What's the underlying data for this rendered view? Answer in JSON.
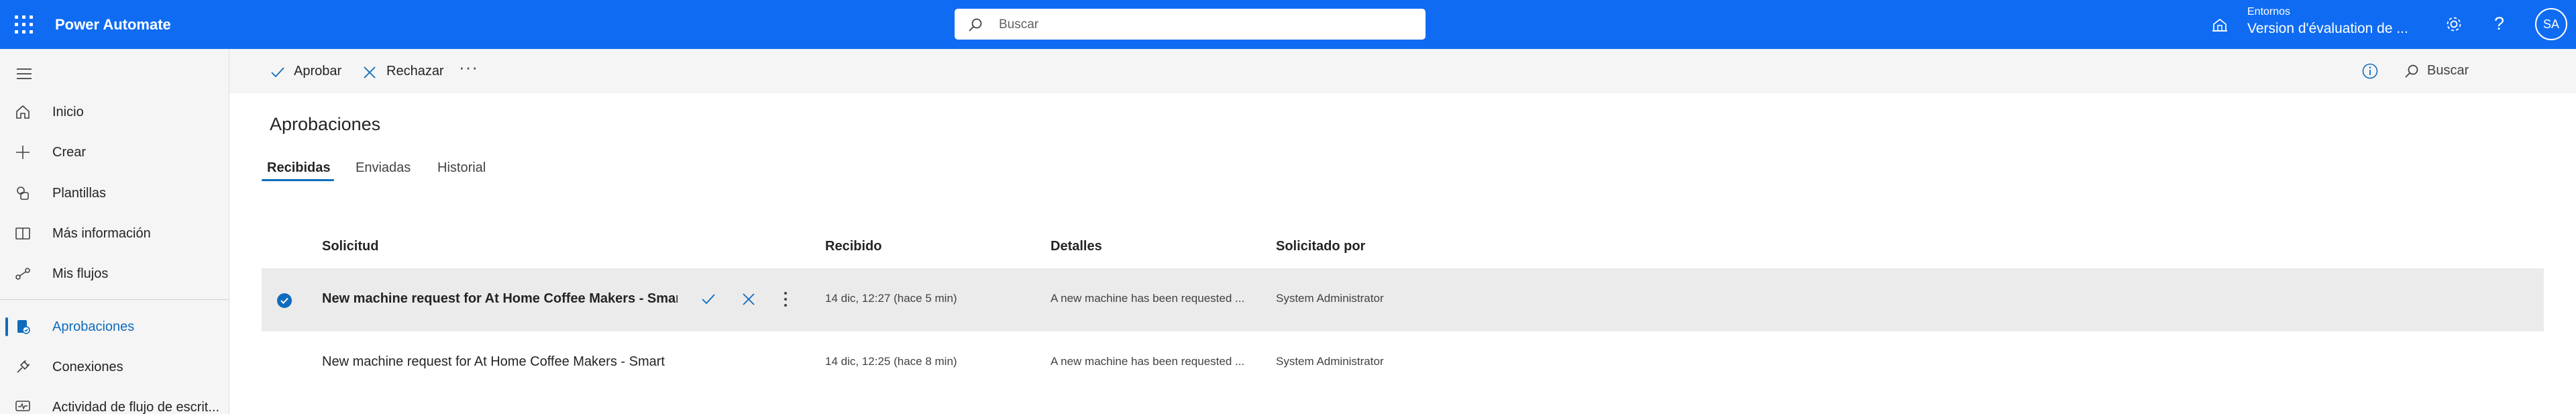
{
  "app": {
    "title": "Power Automate"
  },
  "search": {
    "placeholder": "Buscar"
  },
  "environment": {
    "label": "Entornos",
    "name": "Version d'évaluation de ..."
  },
  "user": {
    "initials": "SA"
  },
  "sidebar": {
    "items": [
      {
        "label": "Inicio",
        "icon": "home-icon"
      },
      {
        "label": "Crear",
        "icon": "plus-icon"
      },
      {
        "label": "Plantillas",
        "icon": "templates-icon"
      },
      {
        "label": "Más información",
        "icon": "book-icon"
      },
      {
        "label": "Mis flujos",
        "icon": "flows-icon"
      },
      {
        "label": "Aprobaciones",
        "icon": "approvals-icon",
        "active": true
      },
      {
        "label": "Conexiones",
        "icon": "plug-icon"
      },
      {
        "label": "Actividad de flujo de escrit...",
        "icon": "desktop-activity-icon"
      }
    ]
  },
  "toolbar": {
    "approve_label": "Aprobar",
    "reject_label": "Rechazar",
    "more_label": "···",
    "search_label": "Buscar"
  },
  "main": {
    "title": "Aprobaciones",
    "tabs": [
      {
        "label": "Recibidas",
        "active": true
      },
      {
        "label": "Enviadas"
      },
      {
        "label": "Historial"
      }
    ],
    "columns": [
      "Solicitud",
      "Recibido",
      "Detalles",
      "Solicitado por"
    ],
    "rows": [
      {
        "request": "New machine request for At Home Coffee Makers - Smart",
        "received": "14 dic, 12:27 (hace 5 min)",
        "details": "A new machine has been requested ...",
        "requested_by": "System Administrator",
        "selected": true
      },
      {
        "request": "New machine request for At Home Coffee Makers - Smart",
        "received": "14 dic, 12:25 (hace 8 min)",
        "details": "A new machine has been requested ...",
        "requested_by": "System Administrator",
        "selected": false
      }
    ]
  },
  "colors": {
    "brand": "#0f6cf2",
    "accent": "#0f6cbd",
    "selected_row": "#ebebeb",
    "sidebar": "#f5f5f5"
  }
}
